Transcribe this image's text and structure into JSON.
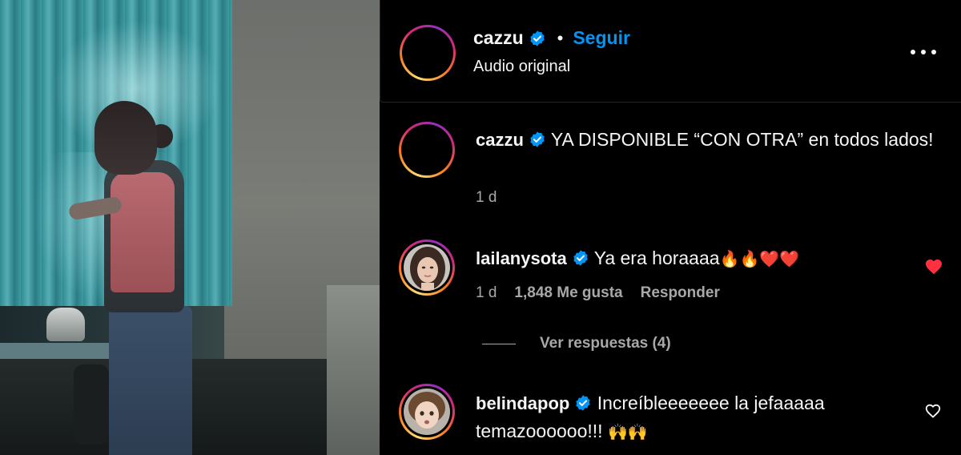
{
  "post": {
    "author": "cazzu",
    "follow_label": "Seguir",
    "separator": "•",
    "audio_label": "Audio original",
    "more_icon": "more-horizontal-icon"
  },
  "caption": {
    "username": "cazzu",
    "text": "YA DISPONIBLE “CON OTRA” en todos lados!",
    "time": "1 d"
  },
  "comments": [
    {
      "username": "lailanysota",
      "text": "Ya era horaaaa",
      "emojis": "🔥🔥❤️❤️",
      "time": "1 d",
      "likes": "1,848 Me gusta",
      "reply_label": "Responder",
      "liked": true,
      "view_replies": "Ver respuestas (4)"
    },
    {
      "username": "belindapop",
      "text": "Increíbleeeeeee la jefaaaaa temazoooooo!!!",
      "emojis": "🙌🙌",
      "liked": false
    }
  ],
  "colors": {
    "background": "#000000",
    "text": "#f5f5f5",
    "secondary": "#a8a8a8",
    "follow": "#0095f6",
    "verified": "#0095f6",
    "liked_heart": "#ff3040"
  }
}
